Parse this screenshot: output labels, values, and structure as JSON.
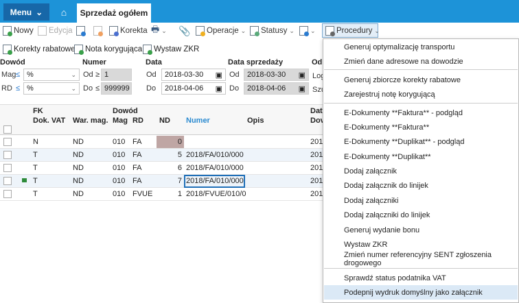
{
  "topbar": {
    "menu": "Menu",
    "tab": "Sprzedaż ogółem"
  },
  "toolbar": {
    "new": "Nowy",
    "edit": "Edycja",
    "correction": "Korekta",
    "operations": "Operacje",
    "statuses": "Statusy",
    "procedures": "Procedury"
  },
  "toolbar2": {
    "rebate": "Korekty rabatowe",
    "note": "Nota korygująca",
    "zkr": "Wystaw ZKR"
  },
  "filters": {
    "dowod": {
      "label": "Dowód",
      "mag_label": "Mag",
      "rd_label": "RD",
      "op": "≤",
      "mag": "%",
      "rd": "%"
    },
    "numer": {
      "label": "Numer",
      "od": "Od",
      "do": "Do",
      "op_od": "≥",
      "op_do": "≤",
      "from": "1",
      "to": "999999"
    },
    "data": {
      "label": "Data",
      "od": "Od",
      "do": "Do",
      "from": "2018-03-30",
      "to": "2018-04-06"
    },
    "data_sprzedazy": {
      "label": "Data sprzedaży",
      "od": "Od",
      "do": "Do",
      "from": "2018-03-30",
      "to": "2018-04-06"
    },
    "odb": {
      "label": "Odb",
      "log": "Log",
      "szu": "Szu"
    }
  },
  "grid": {
    "group_fk": "FK",
    "group_dowod": "Dowód",
    "group_dat": "Dat",
    "columns": [
      "Dok. VAT",
      "War. mag.",
      "Mag",
      "RD",
      "ND",
      "Numer",
      "Opis",
      "Dov"
    ],
    "rows": [
      {
        "vat": "N",
        "war": "ND",
        "mag": "010",
        "rd": "FA",
        "nd": "0",
        "numer": "",
        "dat": "201"
      },
      {
        "vat": "T",
        "war": "ND",
        "mag": "010",
        "rd": "FA",
        "nd": "5",
        "numer": "2018/FA/010/000",
        "dat": "201"
      },
      {
        "vat": "T",
        "war": "ND",
        "mag": "010",
        "rd": "FA",
        "nd": "6",
        "numer": "2018/FA/010/000",
        "dat": "201"
      },
      {
        "vat": "T",
        "war": "ND",
        "mag": "010",
        "rd": "FA",
        "nd": "7",
        "numer": "2018/FA/010/000",
        "dat": "201"
      },
      {
        "vat": "T",
        "war": "ND",
        "mag": "010",
        "rd": "FVUE",
        "nd": "1",
        "numer": "2018/FVUE/010/0",
        "dat": "201"
      }
    ]
  },
  "dropdown": {
    "items": [
      "Generuj optymalizację transportu",
      "Zmień dane adresowe na dowodzie",
      "Generuj zbiorcze korekty rabatowe",
      "Zarejestruj notę korygującą",
      "E-Dokumenty **Faktura** - podgląd",
      "E-Dokumenty **Faktura**",
      "E-Dokumenty **Duplikat** - podgląd",
      "E-Dokumenty **Duplikat**",
      "Dodaj załącznik",
      "Dodaj załącznik do linijek",
      "Dodaj załączniki",
      "Dodaj załączniki do linijek",
      "Generuj wydanie bonu",
      "Wystaw ZKR",
      "Zmień numer referencyjny SENT zgłoszenia drogowego",
      "Sprawdź status podatnika VAT",
      "Podepnij wydruk domyślny jako załącznik"
    ]
  }
}
